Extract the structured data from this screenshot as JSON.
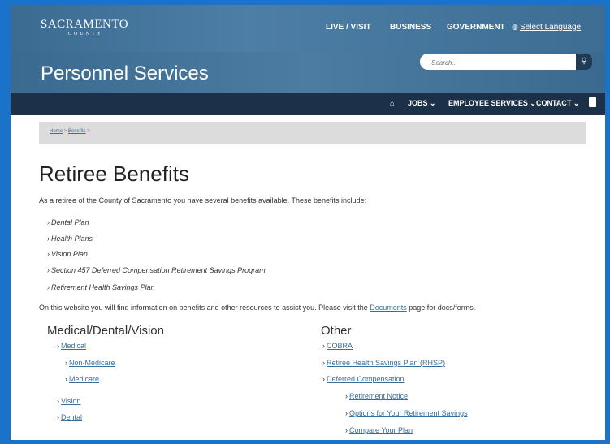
{
  "header": {
    "logo_text": "SACRAMENTO",
    "logo_sub": "COUNTY",
    "top_nav": [
      "LIVE / VISIT",
      "BUSINESS",
      "GOVERNMENT"
    ],
    "select_language": "Select Language",
    "site_title": "Personnel Services",
    "search_placeholder": "Search..."
  },
  "main_nav": {
    "items": [
      "JOBS ⌄",
      "EMPLOYEE SERVICES ⌄",
      "CONTACT ⌄"
    ]
  },
  "breadcrumb": {
    "home": "Home",
    "benefits": "Benefits",
    "sep1": " > ",
    "sep2": " >"
  },
  "page": {
    "title": "Retiree Benefits",
    "intro": "As a retiree of the County of Sacramento you have several benefits available.  These benefits include:",
    "benefits": [
      "Dental Plan",
      "Health Plans",
      "Vision Plan",
      "Section 457 Deferred Compensation Retirement Savings Program",
      "Retirement Health Savings Plan"
    ],
    "outro_before": "On this website you will find information on benefits and other resources to assist you.  Please visit the ",
    "outro_link": "Documents",
    "outro_after": " page for docs/forms."
  },
  "left_col": {
    "title": "Medical/Dental/Vision",
    "links": [
      "Medical",
      "Non-Medicare",
      "Medicare",
      "Vision",
      "Dental"
    ]
  },
  "right_col": {
    "title": "Other",
    "links": [
      "COBRA",
      "Retiree Health Savings Plan (RHSP)",
      "Deferred Compensation",
      "Retirement Notice",
      "Options for Your Retirement Savings",
      "Compare Your Plan"
    ]
  }
}
